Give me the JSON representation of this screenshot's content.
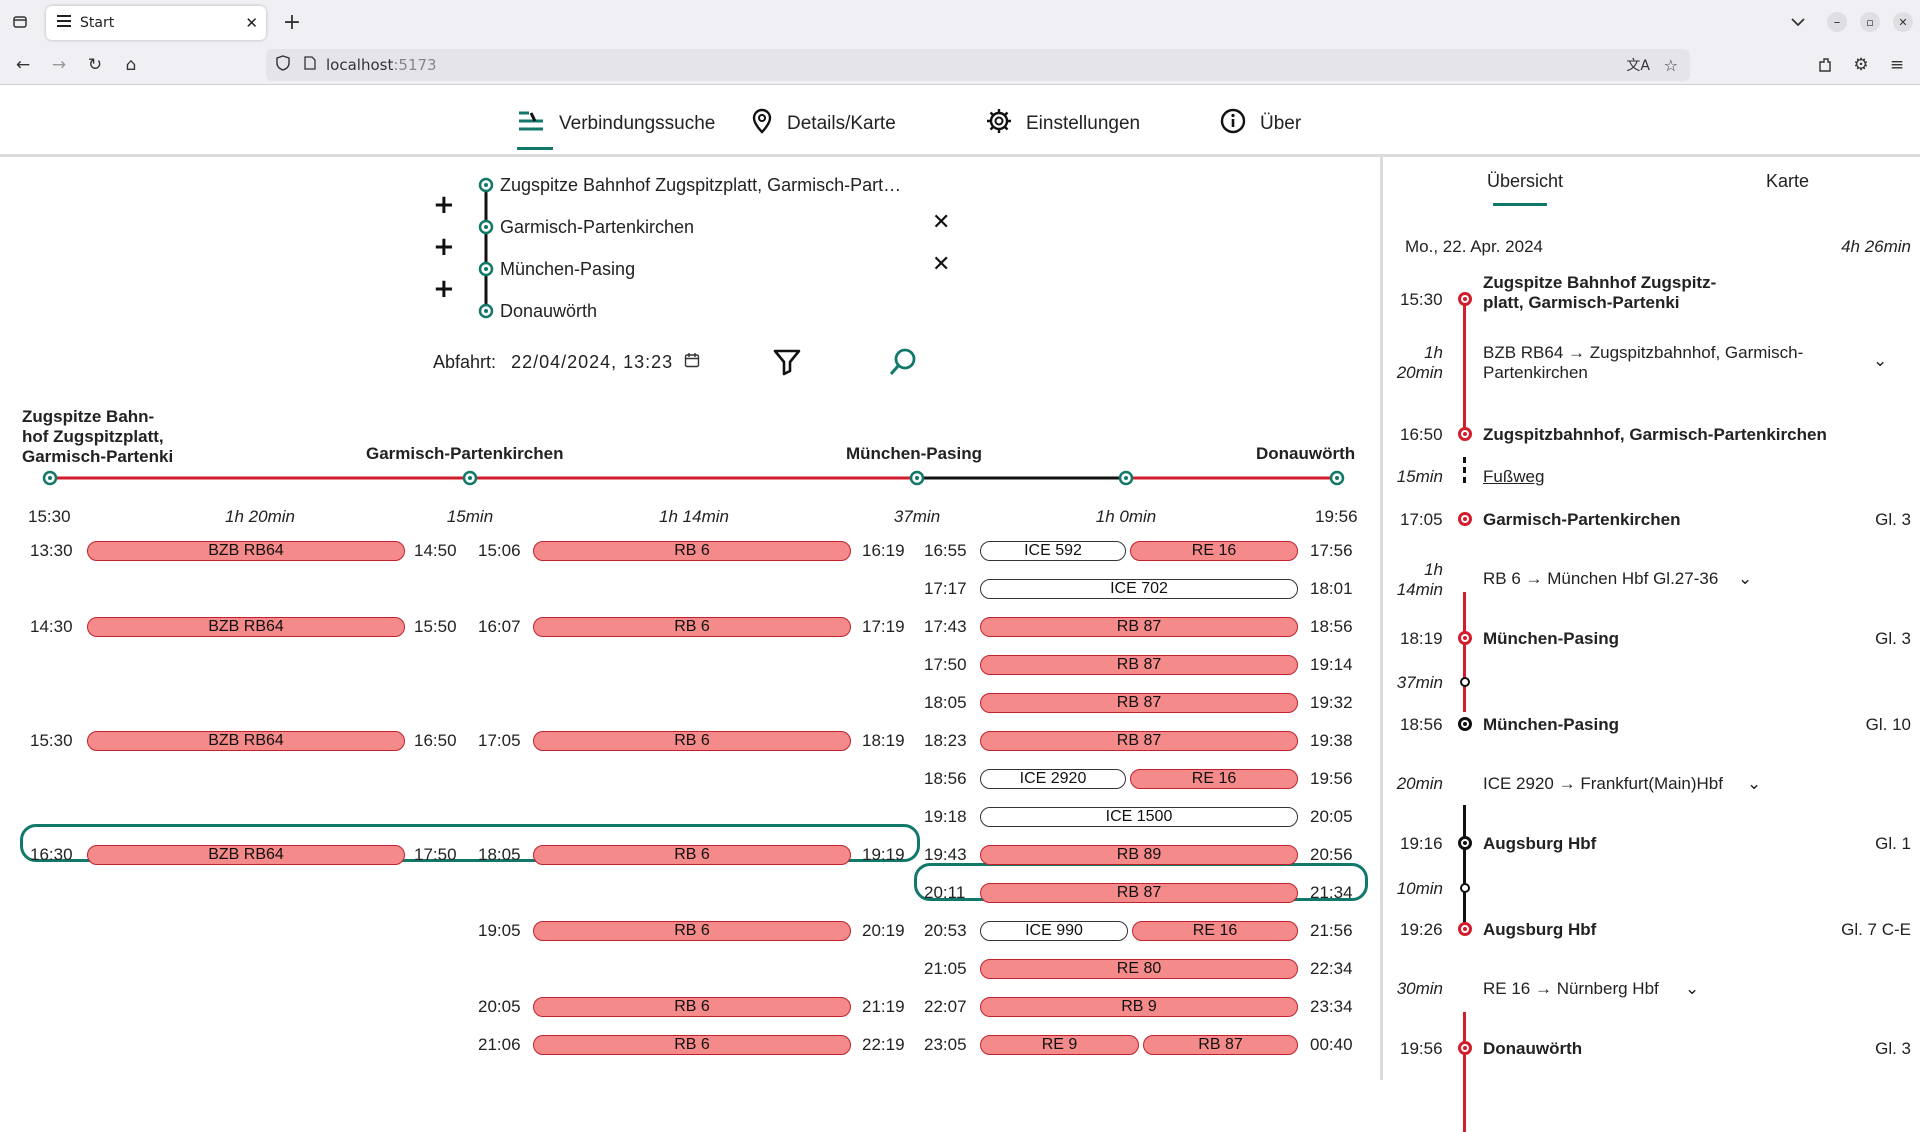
{
  "browser": {
    "tab_title": "Start",
    "url_host": "localhost",
    "url_port": ":5173"
  },
  "nav": {
    "items": [
      {
        "label": "Verbindungssuche"
      },
      {
        "label": "Details/Karte"
      },
      {
        "label": "Einstellungen"
      },
      {
        "label": "Über"
      }
    ]
  },
  "search": {
    "stops": [
      "Zugspitze Bahnhof Zugspitzplatt, Garmisch-Part…",
      "Garmisch-Partenkirchen",
      "München-Pasing",
      "Donauwörth"
    ],
    "departure_label": "Abfahrt:",
    "departure_value": "22/04/2024, 13:23"
  },
  "timeline": {
    "heads": [
      "Zugspitze Bahn-\nhof Zugspitzplatt,\nGarmisch-Partenki",
      "Garmisch-Partenkirchen",
      "München-Pasing",
      "Donauwörth"
    ],
    "start": "15:30",
    "end": "19:56",
    "durations": [
      "1h 20min",
      "15min",
      "1h 14min",
      "37min",
      "1h 0min"
    ]
  },
  "trips": {
    "seg1": [
      {
        "dep": "13:30",
        "train": "BZB RB64",
        "arr": "14:50"
      },
      {
        "dep": "14:30",
        "train": "BZB RB64",
        "arr": "15:50"
      },
      {
        "dep": "15:30",
        "train": "BZB RB64",
        "arr": "16:50"
      },
      {
        "dep": "16:30",
        "train": "BZB RB64",
        "arr": "17:50"
      }
    ],
    "seg2": [
      {
        "dep": "15:06",
        "train": "RB 6",
        "arr": "16:19"
      },
      {
        "dep": "16:07",
        "train": "RB 6",
        "arr": "17:19"
      },
      {
        "dep": "17:05",
        "train": "RB 6",
        "arr": "18:19"
      },
      {
        "dep": "18:05",
        "train": "RB 6",
        "arr": "19:19"
      },
      {
        "dep": "19:05",
        "train": "RB 6",
        "arr": "20:19"
      },
      {
        "dep": "20:05",
        "train": "RB 6",
        "arr": "21:19"
      },
      {
        "dep": "21:06",
        "train": "RB 6",
        "arr": "22:19"
      }
    ],
    "seg3": [
      {
        "dep": "16:55",
        "a": "ICE 592",
        "b": "RE 16",
        "arr": "17:56"
      },
      {
        "dep": "17:17",
        "a": "ICE 702",
        "arr": "18:01"
      },
      {
        "dep": "17:43",
        "a": "RB 87",
        "arr": "18:56"
      },
      {
        "dep": "17:50",
        "a": "RB 87",
        "arr": "19:14"
      },
      {
        "dep": "18:05",
        "a": "RB 87",
        "arr": "19:32"
      },
      {
        "dep": "18:23",
        "a": "RB 87",
        "arr": "19:38"
      },
      {
        "dep": "18:56",
        "a": "ICE 2920",
        "b": "RE 16",
        "arr": "19:56"
      },
      {
        "dep": "19:18",
        "a": "ICE 1500",
        "arr": "20:05"
      },
      {
        "dep": "19:43",
        "a": "RB 89",
        "arr": "20:56"
      },
      {
        "dep": "20:11",
        "a": "RB 87",
        "arr": "21:34"
      },
      {
        "dep": "20:53",
        "a": "ICE 990",
        "b": "RE 16",
        "arr": "21:56"
      },
      {
        "dep": "21:05",
        "a": "RE 80",
        "arr": "22:34"
      },
      {
        "dep": "22:07",
        "a": "RB 9",
        "arr": "23:34"
      },
      {
        "dep": "23:05",
        "a": "RE 9",
        "b": "RB 87",
        "arr": "00:40"
      }
    ]
  },
  "details": {
    "tabs": [
      "Übersicht",
      "Karte"
    ],
    "date": "Mo., 22. Apr. 2024",
    "total": "4h 26min",
    "t1530": "15:30",
    "s1": "Zugspitze Bahnhof Zugspitz-\nplatt, Garmisch-Partenki",
    "d1": "1h\n20min",
    "leg1": "BZB RB64 → Zugspitzbahnhof, Garmisch-\nPartenkirchen",
    "t1650": "16:50",
    "s2": "Zugspitzbahnhof, Garmisch-Partenkirchen",
    "walk_dur": "15min",
    "walk": "Fußweg",
    "t1705": "17:05",
    "s3": "Garmisch-Partenkirchen",
    "p3": "Gl. 3",
    "d2": "1h\n14min",
    "leg2": "RB 6 → München Hbf Gl.27-36",
    "t1819": "18:19",
    "s4": "München-Pasing",
    "p4": "Gl. 3",
    "wait1": "37min",
    "t1856": "18:56",
    "s5": "München-Pasing",
    "p5": "Gl. 10",
    "d3": "20min",
    "leg3": "ICE 2920 → Frankfurt(Main)Hbf",
    "t1916": "19:16",
    "s6": "Augsburg Hbf",
    "p6": "Gl. 1",
    "wait2": "10min",
    "t1926": "19:26",
    "s7": "Augsburg Hbf",
    "p7": "Gl. 7 C-E",
    "d4": "30min",
    "leg4": "RE 16 → Nürnberg Hbf",
    "t1956": "19:56",
    "s8": "Donauwörth",
    "p8": "Gl. 3"
  },
  "colors": {
    "accent": "#11786a",
    "rail_red": "#d21e2c",
    "bar_fill": "#f58a8a"
  }
}
